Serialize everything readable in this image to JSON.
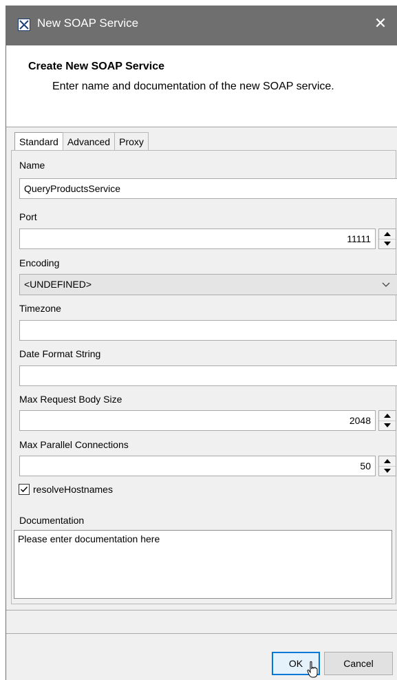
{
  "window": {
    "title": "New SOAP Service",
    "close_glyph": "✕",
    "icon": "magicdraw-icon"
  },
  "header": {
    "title": "Create New SOAP Service",
    "description": "Enter name and documentation of the new SOAP service."
  },
  "tabs": [
    {
      "label": "Standard",
      "active": true
    },
    {
      "label": "Advanced",
      "active": false
    },
    {
      "label": "Proxy",
      "active": false
    }
  ],
  "form": {
    "name": {
      "label": "Name",
      "value": "QueryProductsService"
    },
    "port": {
      "label": "Port",
      "value": "11111"
    },
    "encoding": {
      "label": "Encoding",
      "value": "<UNDEFINED>"
    },
    "timezone": {
      "label": "Timezone",
      "value": ""
    },
    "date_format": {
      "label": "Date Format String",
      "value": ""
    },
    "max_request_body": {
      "label": "Max Request Body Size",
      "value": "2048"
    },
    "max_parallel": {
      "label": "Max Parallel Connections",
      "value": "50"
    },
    "resolve_hostnames": {
      "label": "resolveHostnames",
      "checked": true
    },
    "documentation": {
      "label": "Documentation",
      "value": "Please enter documentation here"
    }
  },
  "buttons": {
    "ok": "OK",
    "cancel": "Cancel"
  },
  "colors": {
    "titlebar": "#6f6f6f",
    "focus": "#0078d7"
  }
}
